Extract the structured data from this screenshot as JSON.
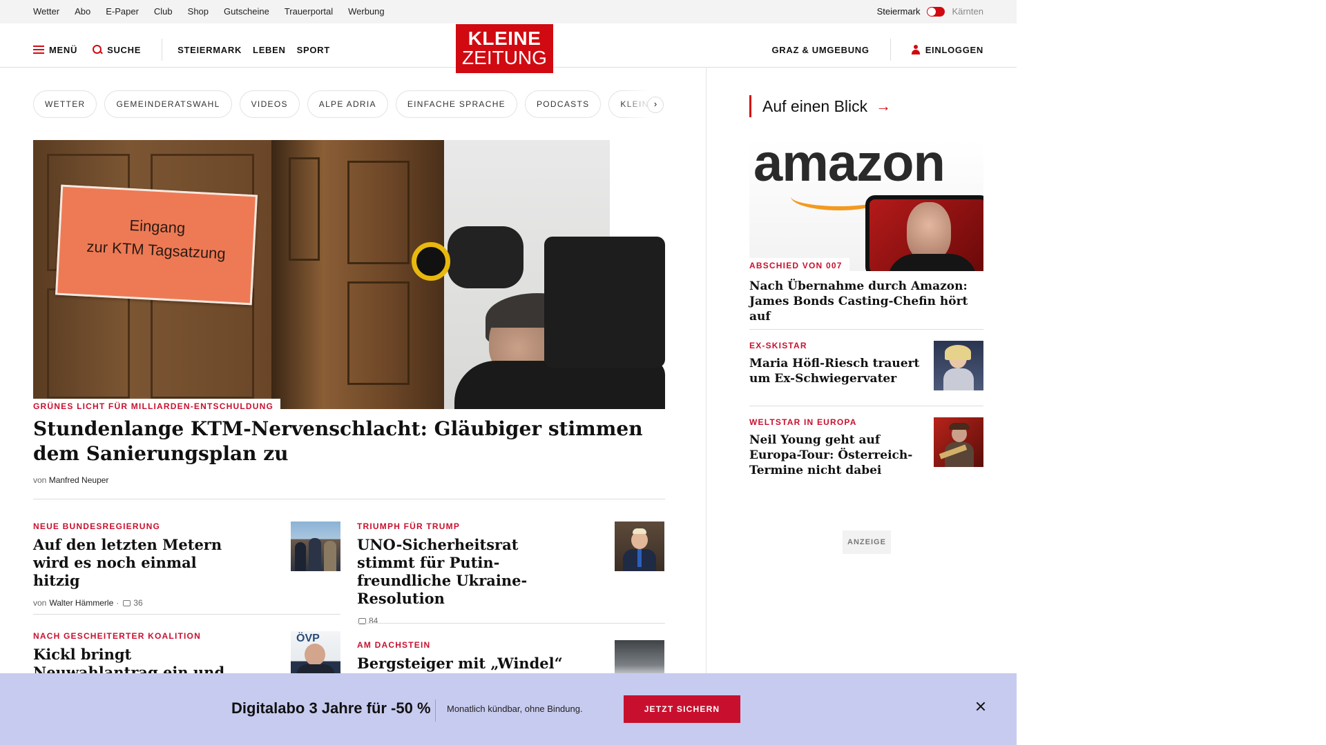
{
  "topbar": {
    "links": [
      "Wetter",
      "Abo",
      "E-Paper",
      "Club",
      "Shop",
      "Gutscheine",
      "Trauerportal",
      "Werbung"
    ],
    "region_active": "Steiermark",
    "region_other": "Kärnten"
  },
  "header": {
    "menu_label": "MENÜ",
    "search_label": "SUCHE",
    "sections": [
      "STEIERMARK",
      "LEBEN",
      "SPORT"
    ],
    "logo_line1": "KLEINE",
    "logo_line2": "ZEITUNG",
    "local_label": "GRAZ & UMGEBUNG",
    "login_label": "EINLOGGEN"
  },
  "pills": [
    "WETTER",
    "GEMEINDERATSWAHL",
    "VIDEOS",
    "ALPE ADRIA",
    "EINFACHE SPRACHE",
    "PODCASTS",
    "KLEINE KINDERZEITUNG"
  ],
  "hero": {
    "sign_line1": "Eingang",
    "sign_line2": "zur KTM Tagsatzung",
    "kicker": "GRÜNES LICHT FÜR MILLIARDEN-ENTSCHULDUNG",
    "title": "Stundenlange KTM-Nervenschlacht: Gläubiger stimmen dem Sanierungsplan zu",
    "byline_prefix": "von",
    "author": "Manfred Neuper"
  },
  "articles": [
    {
      "kicker": "NEUE BUNDESREGIERUNG",
      "title": "Auf den letzten Metern wird es noch einmal hitzig",
      "byline_prefix": "von",
      "author": "Walter Hämmerle",
      "separator": "·",
      "comments": "36"
    },
    {
      "kicker": "TRIUMPH FÜR TRUMP",
      "title": "UNO-Sicherheitsrat stimmt für Putin-freundliche Ukraine-Resolution",
      "comments": "84"
    },
    {
      "kicker": "NACH GESCHEITERTER KOALITION",
      "title": "Kickl bringt Neuwahlantrag ein und ortet „Perversion“"
    },
    {
      "kicker": "AM DACHSTEIN",
      "title": "Bergsteiger mit „Windel“"
    }
  ],
  "sidebar": {
    "heading": "Auf einen Blick",
    "featured": {
      "image_text": "amazon",
      "kicker": "ABSCHIED VON 007",
      "title": "Nach Übernahme durch Amazon: James Bonds Casting-Chefin hört auf"
    },
    "items": [
      {
        "kicker": "EX-SKISTAR",
        "title": "Maria Höfl-Riesch trauert um Ex-Schwiegervater"
      },
      {
        "kicker": "WELTSTAR IN EUROPA",
        "title": "Neil Young geht auf Europa-Tour: Österreich-Termine nicht dabei"
      }
    ],
    "ad_label": "ANZEIGE"
  },
  "promo": {
    "headline": "Digitalabo 3 Jahre für -50 %",
    "subtext": "Monatlich kündbar, ohne Bindung.",
    "button": "JETZT SICHERN"
  },
  "colors": {
    "brand_red": "#d10a11",
    "kicker_red": "#c8102e",
    "promo_bg": "#c7cbef"
  }
}
